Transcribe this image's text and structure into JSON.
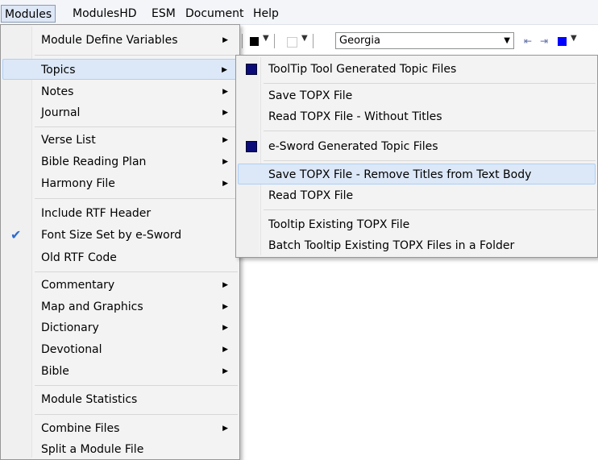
{
  "menubar": {
    "items": [
      "Modules",
      "ModulesHD",
      "ESM",
      "Document",
      "Help"
    ]
  },
  "toolbar": {
    "font": "Georgia",
    "font_color": "#000000",
    "highlight_color": "#ffffff",
    "fill_color": "#0000ff"
  },
  "main_menu": {
    "items": [
      {
        "label": "Module Define Variables",
        "submenu": true
      },
      {
        "label": "Topics",
        "submenu": true,
        "highlighted": true
      },
      {
        "label": "Notes",
        "submenu": true
      },
      {
        "label": "Journal",
        "submenu": true
      },
      {
        "label": "Verse List",
        "submenu": true
      },
      {
        "label": "Bible Reading Plan",
        "submenu": true
      },
      {
        "label": "Harmony File",
        "submenu": true
      },
      {
        "label": "Include RTF Header",
        "submenu": false
      },
      {
        "label": "Font Size Set by e-Sword",
        "submenu": false,
        "checked": true
      },
      {
        "label": "Old RTF Code",
        "submenu": false
      },
      {
        "label": "Commentary",
        "submenu": true
      },
      {
        "label": "Map and Graphics",
        "submenu": true
      },
      {
        "label": "Dictionary",
        "submenu": true
      },
      {
        "label": "Devotional",
        "submenu": true
      },
      {
        "label": "Bible",
        "submenu": true
      },
      {
        "label": "Module Statistics",
        "submenu": false
      },
      {
        "label": "Combine Files",
        "submenu": true
      },
      {
        "label": "Split a Module File",
        "submenu": false
      }
    ]
  },
  "topics_submenu": {
    "items": [
      {
        "label": "ToolTip Tool Generated Topic Files",
        "icon": "blue-square-icon"
      },
      {
        "label": "Save TOPX File"
      },
      {
        "label": "Read TOPX File - Without Titles"
      },
      {
        "label": "e-Sword Generated Topic Files",
        "icon": "blue-square-icon"
      },
      {
        "label": "Save TOPX File - Remove Titles from Text Body",
        "highlighted": true
      },
      {
        "label": "Read TOPX File"
      },
      {
        "label": "Tooltip Existing TOPX File"
      },
      {
        "label": "Batch Tooltip Existing TOPX Files in a Folder"
      }
    ]
  },
  "colors": {
    "menu_bg": "#f3f3f3",
    "highlight_bg": "#dce8f7",
    "highlight_border": "#aecff7",
    "check": "#2e6bd0",
    "topic_icon": "#0b0b7a"
  }
}
